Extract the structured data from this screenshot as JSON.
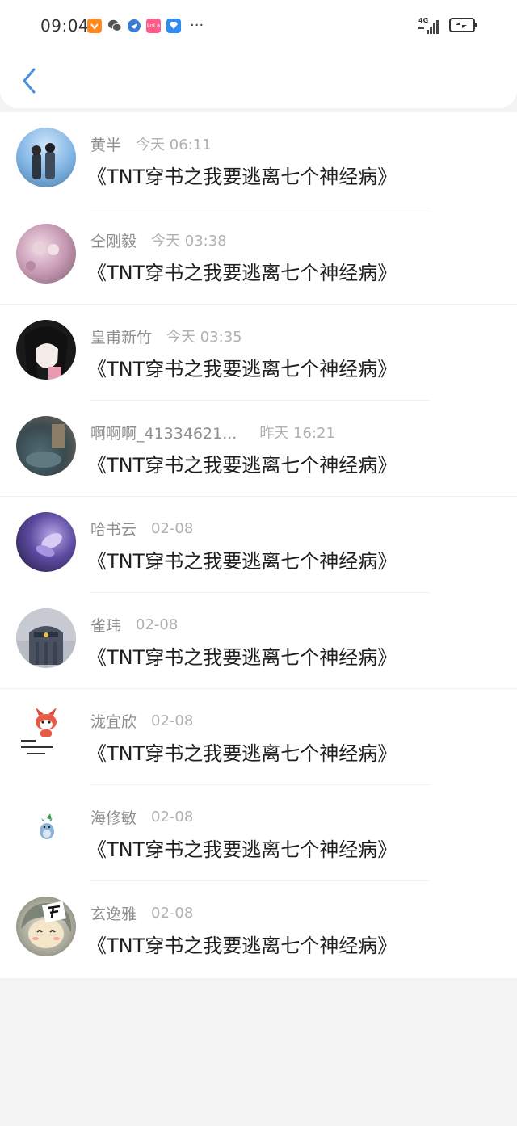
{
  "status_bar": {
    "time": "09:04",
    "more": "···",
    "network": "4G",
    "icons": [
      "taobao-icon",
      "wechat-icon",
      "browser-icon",
      "lofter-icon",
      "store-icon"
    ],
    "right_icons": [
      "signal-icon",
      "battery-icon"
    ]
  },
  "header": {
    "back_icon": "chevron-left-icon"
  },
  "items": [
    {
      "name": "黄半",
      "time": "今天 06:11",
      "message": "《TNT穿书之我要逃离七个神经病》"
    },
    {
      "name": "仝刚毅",
      "time": "今天 03:38",
      "message": "《TNT穿书之我要逃离七个神经病》"
    },
    {
      "name": "皇甫新竹",
      "time": "今天 03:35",
      "message": "《TNT穿书之我要逃离七个神经病》"
    },
    {
      "name": "啊啊啊_41334621...",
      "time": "昨天 16:21",
      "message": "《TNT穿书之我要逃离七个神经病》"
    },
    {
      "name": "哈书云",
      "time": "02-08",
      "message": "《TNT穿书之我要逃离七个神经病》"
    },
    {
      "name": "雀玮",
      "time": "02-08",
      "message": "《TNT穿书之我要逃离七个神经病》"
    },
    {
      "name": "泷宜欣",
      "time": "02-08",
      "message": "《TNT穿书之我要逃离七个神经病》"
    },
    {
      "name": "海修敏",
      "time": "02-08",
      "message": "《TNT穿书之我要逃离七个神经病》"
    },
    {
      "name": "玄逸雅",
      "time": "02-08",
      "message": "《TNT穿书之我要逃离七个神经病》"
    }
  ],
  "colors": {
    "accent": "#4a90e2",
    "page_bg": "#f3f3f3"
  }
}
